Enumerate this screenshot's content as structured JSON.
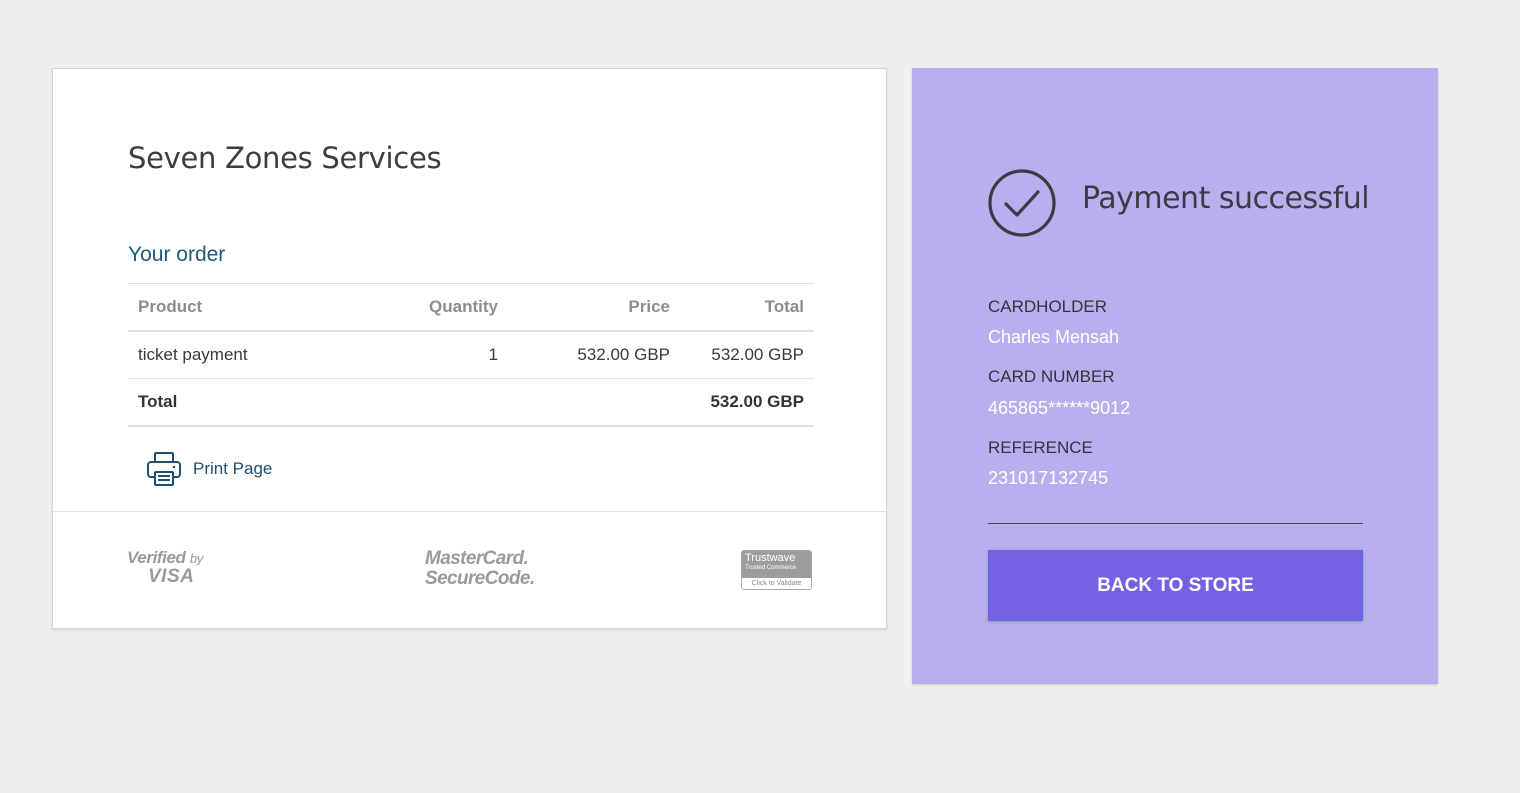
{
  "merchant": {
    "name": "Seven Zones Services"
  },
  "order": {
    "heading": "Your order",
    "columns": {
      "product": "Product",
      "quantity": "Quantity",
      "price": "Price",
      "total": "Total"
    },
    "items": [
      {
        "product": "ticket payment",
        "quantity": "1",
        "price": "532.00 GBP",
        "total": "532.00 GBP"
      }
    ],
    "summary": {
      "label": "Total",
      "amount": "532.00 GBP"
    }
  },
  "print": {
    "label": "Print Page",
    "icon": "printer-icon"
  },
  "logos": {
    "visa": {
      "line1": "Verified",
      "line1_suffix": "by",
      "line2": "VISA"
    },
    "mastercard": {
      "line1": "MasterCard.",
      "line2": "SecureCode."
    },
    "trustwave": {
      "name": "Trustwave",
      "sub": "Trusted Commerce",
      "footer": "Click to Validate"
    }
  },
  "status": {
    "icon": "check-circle-icon",
    "title": "Payment successful",
    "cardholder": {
      "label": "CARDHOLDER",
      "value": "Charles Mensah"
    },
    "card_number": {
      "label": "CARD NUMBER",
      "value": "465865******9012"
    },
    "reference": {
      "label": "REFERENCE",
      "value": "231017132745"
    },
    "button_label": "BACK TO STORE"
  },
  "colors": {
    "page_background": "#efefef",
    "status_panel": "#b8b0ee",
    "button": "#7561e2",
    "heading_blue": "#1f5a76"
  }
}
